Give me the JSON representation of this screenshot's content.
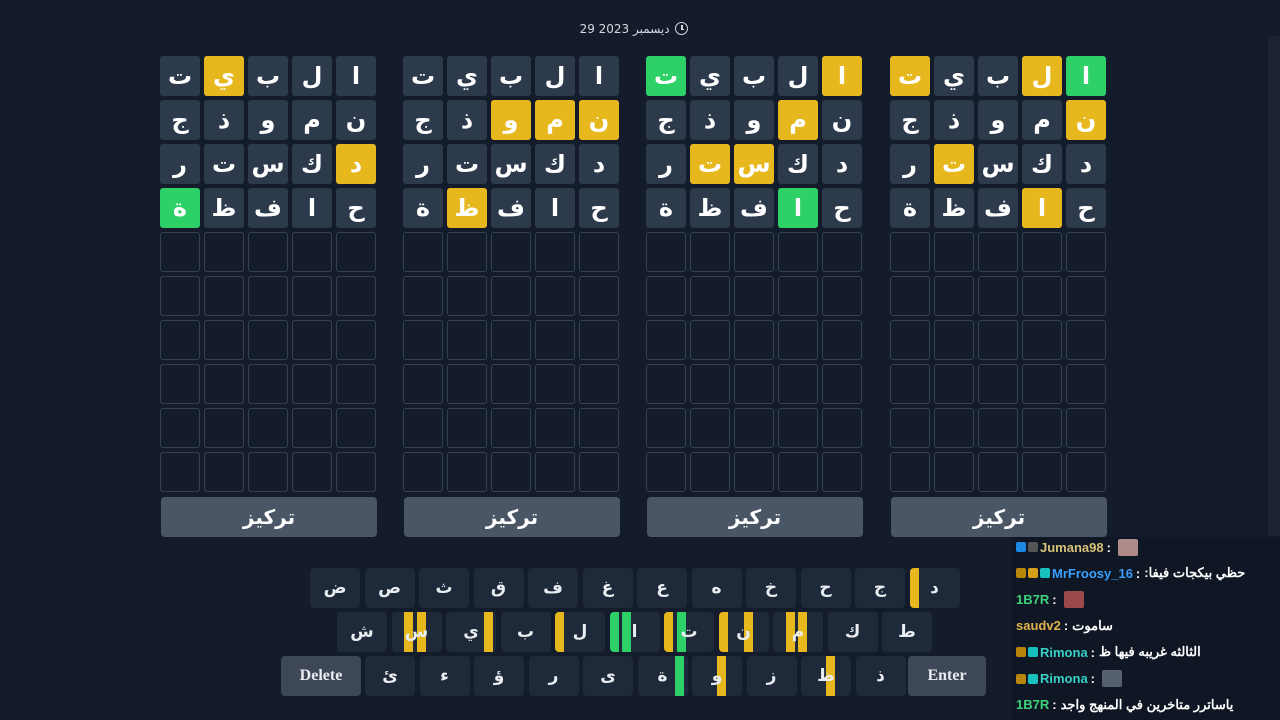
{
  "date": "29 ديسمبر 2023",
  "colors": {
    "background": "#141c2c",
    "tile_absent": "#2c3a4c",
    "tile_present": "#e6b81e",
    "tile_correct": "#2ed167",
    "empty_border": "#334155",
    "focus_button": "#4a5565",
    "key": "#1e2a3a"
  },
  "boards": [
    {
      "focus_label": "تركيز",
      "guesses": [
        {
          "letters": [
            "ا",
            "ل",
            "ب",
            "ي",
            "ت"
          ],
          "states": [
            "n",
            "n",
            "n",
            "y",
            "n"
          ]
        },
        {
          "letters": [
            "ن",
            "م",
            "و",
            "ذ",
            "ج"
          ],
          "states": [
            "n",
            "n",
            "n",
            "n",
            "n"
          ]
        },
        {
          "letters": [
            "د",
            "ك",
            "س",
            "ت",
            "ر"
          ],
          "states": [
            "y",
            "n",
            "n",
            "n",
            "n"
          ]
        },
        {
          "letters": [
            "ح",
            "ا",
            "ف",
            "ظ",
            "ة"
          ],
          "states": [
            "n",
            "n",
            "n",
            "n",
            "g"
          ]
        }
      ]
    },
    {
      "focus_label": "تركيز",
      "guesses": [
        {
          "letters": [
            "ا",
            "ل",
            "ب",
            "ي",
            "ت"
          ],
          "states": [
            "n",
            "n",
            "n",
            "n",
            "n"
          ]
        },
        {
          "letters": [
            "ن",
            "م",
            "و",
            "ذ",
            "ج"
          ],
          "states": [
            "y",
            "y",
            "y",
            "n",
            "n"
          ]
        },
        {
          "letters": [
            "د",
            "ك",
            "س",
            "ت",
            "ر"
          ],
          "states": [
            "n",
            "n",
            "n",
            "n",
            "n"
          ]
        },
        {
          "letters": [
            "ح",
            "ا",
            "ف",
            "ظ",
            "ة"
          ],
          "states": [
            "n",
            "n",
            "n",
            "y",
            "n"
          ]
        }
      ]
    },
    {
      "focus_label": "تركيز",
      "guesses": [
        {
          "letters": [
            "ا",
            "ل",
            "ب",
            "ي",
            "ت"
          ],
          "states": [
            "y",
            "n",
            "n",
            "n",
            "g"
          ]
        },
        {
          "letters": [
            "ن",
            "م",
            "و",
            "ذ",
            "ج"
          ],
          "states": [
            "n",
            "y",
            "n",
            "n",
            "n"
          ]
        },
        {
          "letters": [
            "د",
            "ك",
            "س",
            "ت",
            "ر"
          ],
          "states": [
            "n",
            "n",
            "y",
            "y",
            "n"
          ]
        },
        {
          "letters": [
            "ح",
            "ا",
            "ف",
            "ظ",
            "ة"
          ],
          "states": [
            "n",
            "g",
            "n",
            "n",
            "n"
          ]
        }
      ]
    },
    {
      "focus_label": "تركيز",
      "guesses": [
        {
          "letters": [
            "ا",
            "ل",
            "ب",
            "ي",
            "ت"
          ],
          "states": [
            "g",
            "y",
            "n",
            "n",
            "y"
          ]
        },
        {
          "letters": [
            "ن",
            "م",
            "و",
            "ذ",
            "ج"
          ],
          "states": [
            "y",
            "n",
            "n",
            "n",
            "n"
          ]
        },
        {
          "letters": [
            "د",
            "ك",
            "س",
            "ت",
            "ر"
          ],
          "states": [
            "n",
            "n",
            "n",
            "y",
            "n"
          ]
        },
        {
          "letters": [
            "ح",
            "ا",
            "ف",
            "ظ",
            "ة"
          ],
          "states": [
            "n",
            "y",
            "n",
            "n",
            "n"
          ]
        }
      ]
    }
  ],
  "keyboard": {
    "row1": [
      {
        "label": "ض"
      },
      {
        "label": "ص"
      },
      {
        "label": "ث"
      },
      {
        "label": "ق"
      },
      {
        "label": "ف"
      },
      {
        "label": "غ"
      },
      {
        "label": "ع"
      },
      {
        "label": "ه"
      },
      {
        "label": "خ"
      },
      {
        "label": "ح"
      },
      {
        "label": "ج"
      },
      {
        "label": "د",
        "marks": [
          "",
          "",
          "",
          "y"
        ]
      }
    ],
    "row2": [
      {
        "label": "ش"
      },
      {
        "label": "س",
        "marks": [
          "",
          "y",
          "y",
          ""
        ]
      },
      {
        "label": "ي",
        "marks": [
          "y",
          "",
          "",
          ""
        ]
      },
      {
        "label": "ب"
      },
      {
        "label": "ل",
        "marks": [
          "",
          "",
          "",
          "y"
        ]
      },
      {
        "label": "ا",
        "marks": [
          "",
          "",
          "g",
          "g"
        ]
      },
      {
        "label": "ت",
        "marks": [
          "",
          "",
          "g",
          "y"
        ]
      },
      {
        "label": "ن",
        "marks": [
          "",
          "y",
          "",
          "y"
        ]
      },
      {
        "label": "م",
        "marks": [
          "",
          "y",
          "y",
          ""
        ]
      },
      {
        "label": "ك"
      },
      {
        "label": "ط"
      }
    ],
    "row3": [
      {
        "label": "Delete"
      },
      {
        "label": "ئ"
      },
      {
        "label": "ء"
      },
      {
        "label": "ؤ"
      },
      {
        "label": "ر"
      },
      {
        "label": "ى"
      },
      {
        "label": "ة",
        "marks": [
          "g",
          "",
          "",
          ""
        ]
      },
      {
        "label": "و",
        "marks": [
          "",
          "y",
          "",
          ""
        ]
      },
      {
        "label": "ز"
      },
      {
        "label": "ظ",
        "marks": [
          "",
          "y",
          "",
          ""
        ]
      },
      {
        "label": "ذ"
      },
      {
        "label": "Enter"
      }
    ]
  },
  "chat": [
    {
      "user": "Jumana98",
      "sep": " :",
      "text": "",
      "user_color": "#d9c27a",
      "badges": [
        "#1e88e5",
        "#555555"
      ],
      "emote": "#b08a8a"
    },
    {
      "user": "MrFroosy_16",
      "sep": " :",
      "text": "حظي بيكجات فيفا:",
      "user_color": "#3aa0ff",
      "badges": [
        "#b8860b",
        "#d4a017",
        "#19c0c0"
      ],
      "emote": ""
    },
    {
      "user": "1B7R",
      "sep": " :",
      "text": "",
      "user_color": "#3fd17a",
      "badges": [],
      "emote": "#9a4a4a"
    },
    {
      "user": "saudv2",
      "sep": " :",
      "text": "ساموت",
      "user_color": "#e0b24a",
      "badges": [],
      "emote": ""
    },
    {
      "user": "Rimona",
      "sep": " :",
      "text": "الثالثه غريبه فيها ظ",
      "user_color": "#39d0c8",
      "badges": [
        "#b8860b",
        "#19c0c0"
      ],
      "emote": ""
    },
    {
      "user": "Rimona",
      "sep": " :",
      "text": "",
      "user_color": "#39d0c8",
      "badges": [
        "#b8860b",
        "#19c0c0"
      ],
      "emote": "#556070"
    },
    {
      "user": "1B7R",
      "sep": " :",
      "text": "ياساترر متاخرين في المنهج واجد",
      "user_color": "#3fd17a",
      "badges": [],
      "emote": ""
    }
  ]
}
